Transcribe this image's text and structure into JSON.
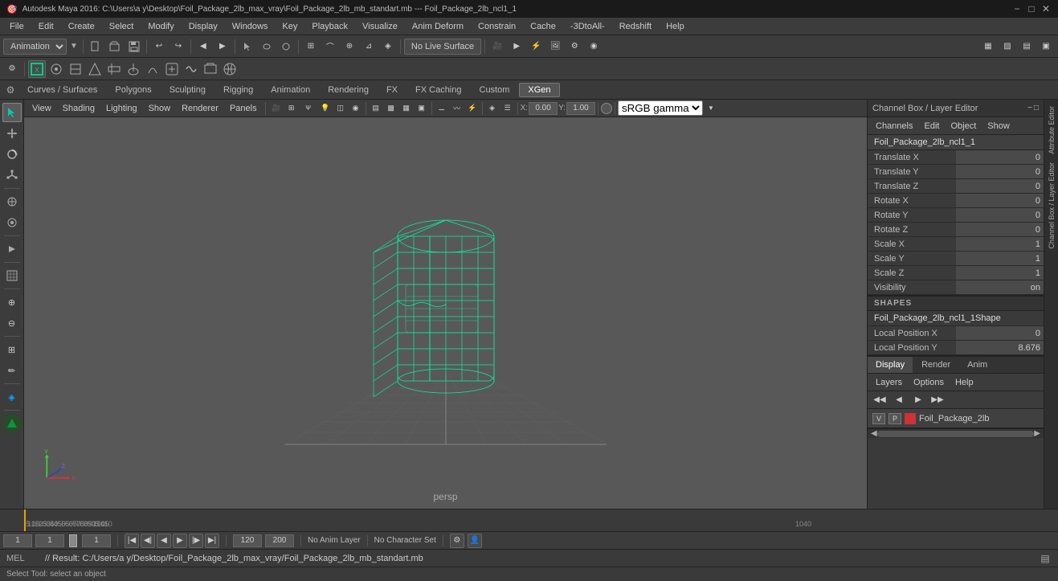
{
  "titlebar": {
    "icon": "🎯",
    "title": "Autodesk Maya 2016: C:\\Users\\a y\\Desktop\\Foil_Package_2lb_max_vray\\Foil_Package_2lb_mb_standart.mb  ---  Foil_Package_2lb_ncl1_1",
    "min": "−",
    "max": "□",
    "close": "✕"
  },
  "menubar": {
    "items": [
      "File",
      "Edit",
      "Create",
      "Select",
      "Modify",
      "Display",
      "Windows",
      "Key",
      "Playback",
      "Visualize",
      "Anim Deform",
      "Constrain",
      "Cache",
      "-3DtoAll-",
      "Redshift",
      "Help"
    ]
  },
  "toolbar1": {
    "dropdown": "Animation",
    "live_surface": "No Live Surface"
  },
  "module_tabs": {
    "items": [
      "Curves / Surfaces",
      "Polygons",
      "Sculpting",
      "Rigging",
      "Animation",
      "Rendering",
      "FX",
      "FX Caching",
      "Custom",
      "XGen"
    ],
    "active": "XGen"
  },
  "viewport": {
    "menu_items": [
      "View",
      "Shading",
      "Lighting",
      "Show",
      "Renderer",
      "Panels"
    ],
    "label": "persp",
    "gamma": "sRGB gamma",
    "cam_pos_x": "0.00",
    "cam_pos_y": "1.00"
  },
  "channel_box": {
    "title": "Channel Box / Layer Editor",
    "menu": [
      "Channels",
      "Edit",
      "Object",
      "Show"
    ],
    "object_name": "Foil_Package_2lb_ncl1_1",
    "channels": [
      {
        "label": "Translate X",
        "value": "0"
      },
      {
        "label": "Translate Y",
        "value": "0"
      },
      {
        "label": "Translate Z",
        "value": "0"
      },
      {
        "label": "Rotate X",
        "value": "0"
      },
      {
        "label": "Rotate Y",
        "value": "0"
      },
      {
        "label": "Rotate Z",
        "value": "0"
      },
      {
        "label": "Scale X",
        "value": "1"
      },
      {
        "label": "Scale Y",
        "value": "1"
      },
      {
        "label": "Scale Z",
        "value": "1"
      },
      {
        "label": "Visibility",
        "value": "on"
      }
    ],
    "shapes_header": "SHAPES",
    "shape_name": "Foil_Package_2lb_ncl1_1Shape",
    "shape_channels": [
      {
        "label": "Local Position X",
        "value": "0"
      },
      {
        "label": "Local Position Y",
        "value": "8.676"
      }
    ],
    "panel_tabs": [
      "Display",
      "Render",
      "Anim"
    ],
    "active_panel_tab": "Display",
    "panel_menu": [
      "Layers",
      "Options",
      "Help"
    ],
    "layer_name": "Foil_Package_2lb",
    "scroll_right": "▶"
  },
  "timeline": {
    "ticks": [
      "5",
      "10",
      "15",
      "20",
      "25",
      "30",
      "35",
      "40",
      "45",
      "50",
      "55",
      "60",
      "65",
      "70",
      "75",
      "80",
      "85",
      "90",
      "95",
      "100",
      "105",
      "110",
      "1040"
    ],
    "current_frame_left": "1",
    "current_frame_right": "1",
    "range_start": "1",
    "range_end": "120",
    "total_frames": "200",
    "anim_layer": "No Anim Layer",
    "char_set": "No Character Set"
  },
  "bottom_controls": {
    "frame_current": "1",
    "frame_current2": "1",
    "frame_display": "1",
    "range_end": "120",
    "range_total": "200"
  },
  "statusbar": {
    "mode": "MEL",
    "result_text": "// Result: C:/Users/a y/Desktop/Foil_Package_2lb_max_vray/Foil_Package_2lb_mb_standart.mb",
    "tooltip": "Select Tool: select an object"
  },
  "attr_sidebar": {
    "label1": "Attribute Editor",
    "label2": "Channel Box / Layer Editor"
  }
}
